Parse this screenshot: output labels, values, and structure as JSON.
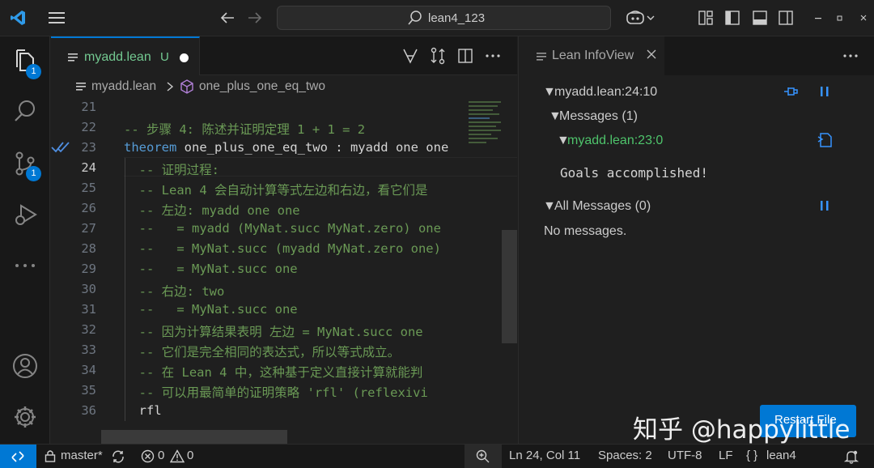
{
  "titlebar": {
    "search_label": "lean4_123"
  },
  "activity": {
    "explorer_badge": "1",
    "scm_badge": "1"
  },
  "editor": {
    "tab_name": "myadd.lean",
    "tab_status": "U",
    "breadcrumb_file": "myadd.lean",
    "breadcrumb_symbol": "one_plus_one_eq_two",
    "lines": [
      {
        "num": "21",
        "text": ""
      },
      {
        "num": "22",
        "text": "-- 步骤 4: 陈述并证明定理 1 + 1 = 2"
      },
      {
        "num": "23",
        "kw": "theorem",
        "text": " one_plus_one_eq_two : myadd one one"
      },
      {
        "num": "24",
        "text": "  -- 证明过程:"
      },
      {
        "num": "25",
        "text": "  -- Lean 4 会自动计算等式左边和右边，看它们是"
      },
      {
        "num": "26",
        "text": "  -- 左边: myadd one one"
      },
      {
        "num": "27",
        "text": "  --   = myadd (MyNat.succ MyNat.zero) one"
      },
      {
        "num": "28",
        "text": "  --   = MyNat.succ (myadd MyNat.zero one)"
      },
      {
        "num": "29",
        "text": "  --   = MyNat.succ one"
      },
      {
        "num": "30",
        "text": "  -- 右边: two"
      },
      {
        "num": "31",
        "text": "  --   = MyNat.succ one"
      },
      {
        "num": "32",
        "text": "  -- 因为计算结果表明 左边 = MyNat.succ one"
      },
      {
        "num": "33",
        "text": "  -- 它们是完全相同的表达式，所以等式成立。"
      },
      {
        "num": "34",
        "text": "  -- 在 Lean 4 中，这种基于定义直接计算就能判"
      },
      {
        "num": "35",
        "text": "  -- 可以用最简单的证明策略 'rfl' (reflexivi"
      },
      {
        "num": "36",
        "text": "  rfl",
        "plain": true
      }
    ],
    "current_line": "24"
  },
  "infoview": {
    "tab_title": "Lean InfoView",
    "position": "myadd.lean:24:10",
    "messages_header": "Messages (1)",
    "message_location": "myadd.lean:23:0",
    "goals_text": "Goals accomplished!",
    "all_messages_header": "All Messages (0)",
    "no_messages": "No messages.",
    "restart_button": "Restart File"
  },
  "statusbar": {
    "branch": "master*",
    "errors": "0",
    "warnings": "0",
    "cursor": "Ln 24, Col 11",
    "spaces": "Spaces: 2",
    "encoding": "UTF-8",
    "eol": "LF",
    "language": "lean4"
  },
  "watermark": "知乎 @happylittle",
  "colors": {
    "accent": "#0078d4",
    "comment": "#6a9955",
    "keyword": "#569cd6",
    "untracked": "#73c991"
  }
}
